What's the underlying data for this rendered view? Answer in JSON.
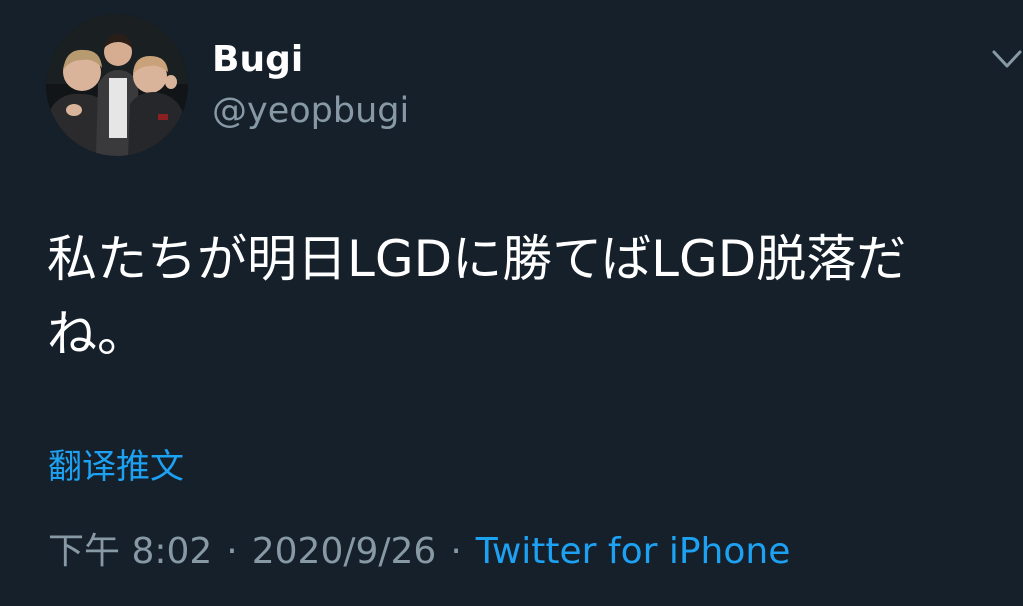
{
  "user": {
    "display_name": "Bugi",
    "handle": "@yeopbugi"
  },
  "tweet": {
    "text": "私たちが明日LGDに勝てばLGD脱落だね。",
    "translate_label": "翻译推文",
    "time": "下午 8:02",
    "date": "2020/9/26",
    "separator": "·",
    "source": "Twitter for iPhone"
  },
  "icons": {
    "avatar": "profile-photo-three-people",
    "menu": "chevron-down-icon"
  },
  "colors": {
    "background": "#15202b",
    "text_primary": "#ffffff",
    "text_secondary": "#8899a6",
    "link": "#1da1f2"
  }
}
